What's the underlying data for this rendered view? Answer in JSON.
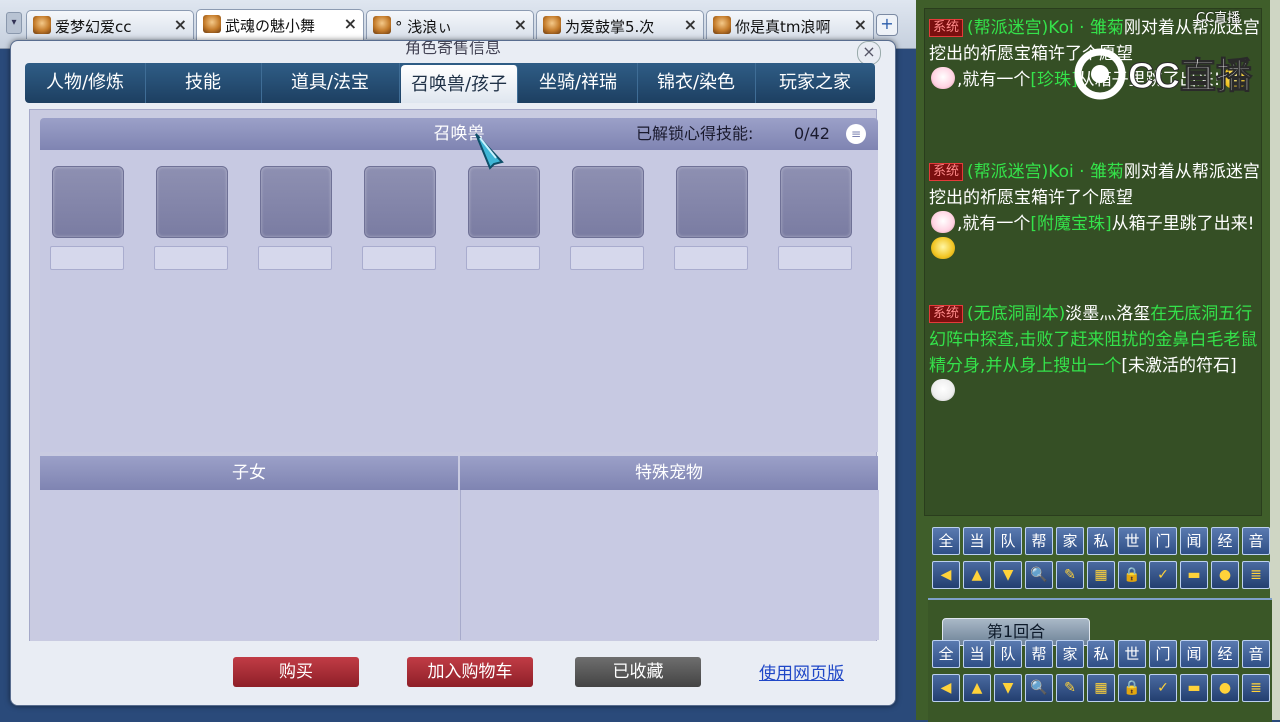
{
  "browser_tabs": [
    {
      "label": "爱梦幻爱cc",
      "close": "×",
      "active": false
    },
    {
      "label": "武魂の魅小舞",
      "close": "×",
      "active": true
    },
    {
      "label": "° 浅浪ぃ",
      "close": "×",
      "active": false
    },
    {
      "label": "为爱鼓掌5.次",
      "close": "×",
      "active": false
    },
    {
      "label": "你是真tm浪啊",
      "close": "×",
      "active": false
    }
  ],
  "add_tab": "+",
  "window": {
    "title": "角色寄售信息",
    "close": "×"
  },
  "nav_tabs": [
    {
      "label": "人物/修炼"
    },
    {
      "label": "技能"
    },
    {
      "label": "道具/法宝"
    },
    {
      "label": "召唤兽/孩子"
    },
    {
      "label": "坐骑/祥瑞"
    },
    {
      "label": "锦衣/染色"
    },
    {
      "label": "玩家之家"
    }
  ],
  "pet_section": {
    "title": "召唤兽",
    "skill_label": "已解锁心得技能:",
    "skill_count": "0/42",
    "menu_icon": "≡",
    "slot_count": 8
  },
  "children_section": {
    "title": "子女"
  },
  "special_pets_section": {
    "title": "特殊宠物"
  },
  "actions": {
    "buy": "购买",
    "add_to_cart": "加入购物车",
    "favorited": "已收藏",
    "web_version": "使用网页版"
  },
  "chat": {
    "messages": [
      {
        "tag": "系统",
        "text1": "(帮派迷宫)Koi · 雏菊",
        "text2": "刚对着从帮派迷宫挖出的祈愿宝箱许了个愿望",
        "text3": ",就有一个",
        "item": "[珍珠]",
        "text4": "从箱子里跳了出来!"
      },
      {
        "tag": "系统",
        "text1": "(帮派迷宫)Koi · 雏菊",
        "text2": "刚对着从帮派迷宫挖出的祈愿宝箱许了个愿望",
        "text3": ",就有一个",
        "item": "[附魔宝珠]",
        "text4": "从箱子里跳了出来!"
      },
      {
        "tag": "系统",
        "text1": "(无底洞副本)",
        "name": "淡墨灬洛玺",
        "text2": "在无底洞五行幻阵中探查,击败了赶来阻扰的金鼻白毛老鼠精分身,并从身上搜出一个",
        "item": "[未激活的符石]"
      }
    ],
    "channels": [
      "全",
      "当",
      "队",
      "帮",
      "家",
      "私",
      "世",
      "门",
      "闻",
      "经",
      "音"
    ],
    "tools": [
      "◀",
      "▲",
      "▼",
      "🔍",
      "✎",
      "▦",
      "🔒",
      "✓",
      "▬",
      "●",
      "≣"
    ],
    "round_label": "第1回合",
    "watermark_small": "CC直播",
    "watermark_big": "CC直播"
  },
  "colors": {
    "system_green": "#34e24a",
    "button_red": "#a52a33",
    "nav_blue": "#244a70",
    "pane_lavender": "#c8cae3"
  }
}
